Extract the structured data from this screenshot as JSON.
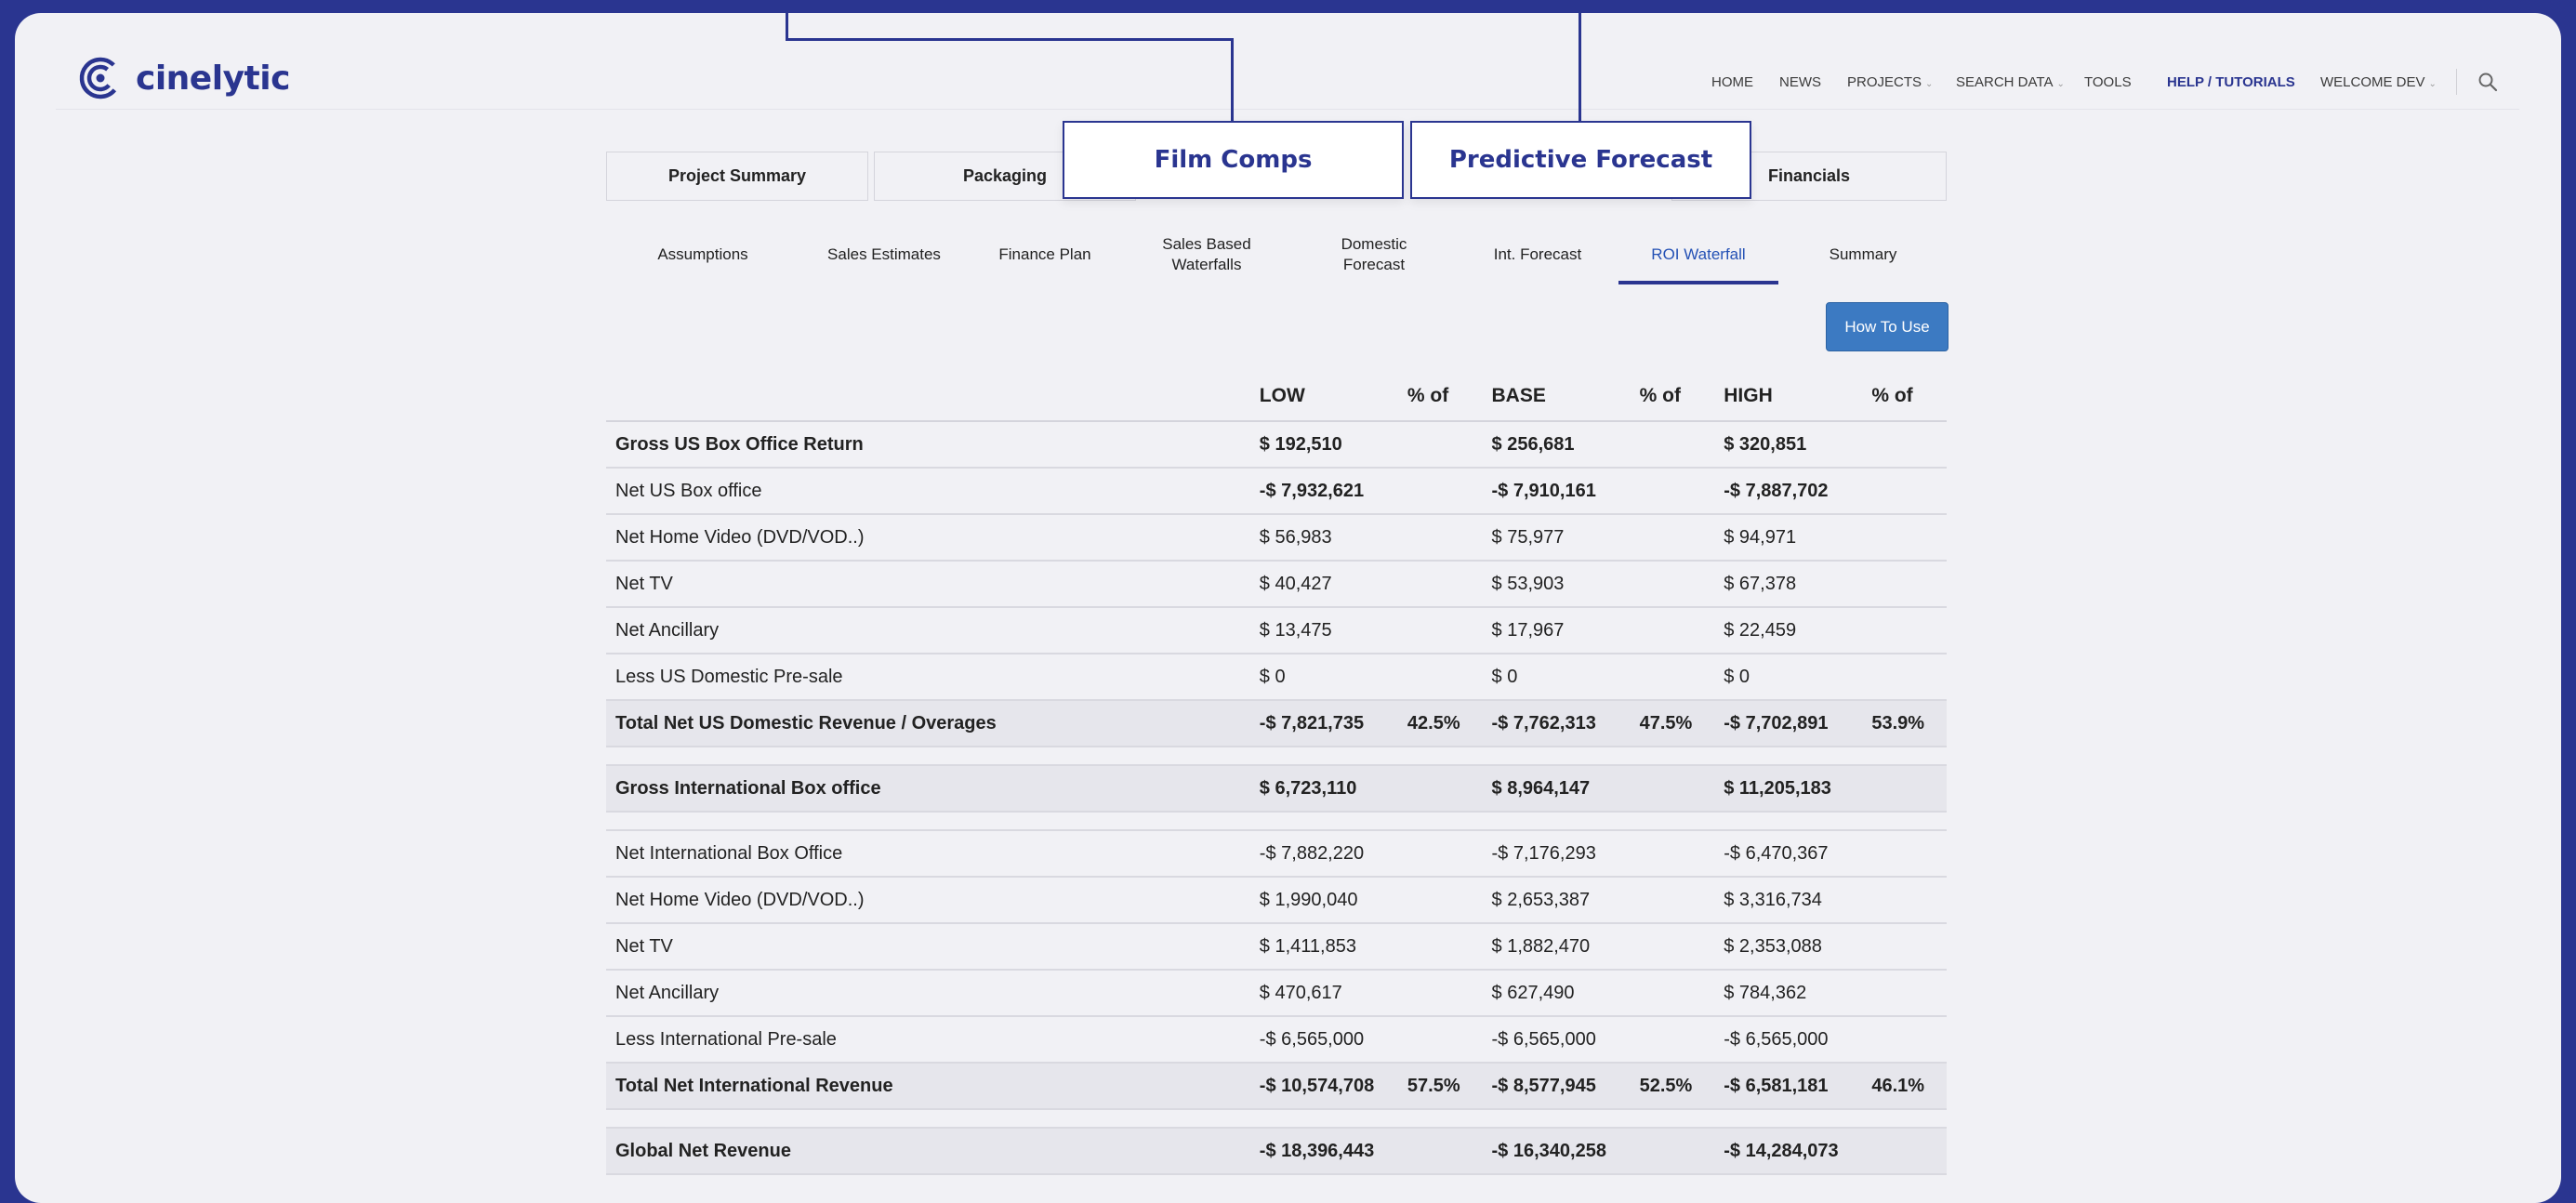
{
  "brand": {
    "name": "cinelytic"
  },
  "nav": {
    "home": "HOME",
    "news": "NEWS",
    "projects": "PROJECTS",
    "search_data": "SEARCH DATA",
    "tools": "TOOLS",
    "help": "HELP / TUTORIALS",
    "welcome": "WELCOME DEV"
  },
  "main_tabs": {
    "project_summary": "Project Summary",
    "packaging": "Packaging",
    "film_comps": "Film Comps",
    "predictive_forecast": "Predictive Forecast",
    "financials": "Financials"
  },
  "sub_tabs": {
    "assumptions": "Assumptions",
    "sales_estimates": "Sales Estimates",
    "finance_plan": "Finance Plan",
    "sales_waterfalls_1": "Sales Based",
    "sales_waterfalls_2": "Waterfalls",
    "domestic_forecast_1": "Domestic",
    "domestic_forecast_2": "Forecast",
    "int_forecast": "Int. Forecast",
    "roi_waterfall": "ROI Waterfall",
    "summary": "Summary"
  },
  "how_to_use": "How To Use",
  "table": {
    "headers": {
      "low": "LOW",
      "pct1": "% of",
      "base": "BASE",
      "pct2": "% of",
      "high": "HIGH",
      "pct3": "% of"
    },
    "rows": [
      {
        "label": "Gross US Box Office Return",
        "low": "$ 192,510",
        "low_pct": "",
        "base": "$ 256,681",
        "base_pct": "",
        "high": "$ 320,851",
        "high_pct": ""
      },
      {
        "label": "Net US Box office",
        "low": "-$ 7,932,621",
        "low_pct": "",
        "base": "-$ 7,910,161",
        "base_pct": "",
        "high": "-$ 7,887,702",
        "high_pct": ""
      },
      {
        "label": "Net Home Video (DVD/VOD..)",
        "low": "$ 56,983",
        "low_pct": "",
        "base": "$ 75,977",
        "base_pct": "",
        "high": "$ 94,971",
        "high_pct": ""
      },
      {
        "label": "Net TV",
        "low": "$ 40,427",
        "low_pct": "",
        "base": "$ 53,903",
        "base_pct": "",
        "high": "$ 67,378",
        "high_pct": ""
      },
      {
        "label": "Net Ancillary",
        "low": "$ 13,475",
        "low_pct": "",
        "base": "$ 17,967",
        "base_pct": "",
        "high": "$ 22,459",
        "high_pct": ""
      },
      {
        "label": "Less US Domestic Pre-sale",
        "low": "$ 0",
        "low_pct": "",
        "base": "$ 0",
        "base_pct": "",
        "high": "$ 0",
        "high_pct": ""
      },
      {
        "label": "Total Net US Domestic Revenue / Overages",
        "low": "-$ 7,821,735",
        "low_pct": "42.5%",
        "base": "-$ 7,762,313",
        "base_pct": "47.5%",
        "high": "-$ 7,702,891",
        "high_pct": "53.9%"
      },
      {
        "label": "Gross International Box office",
        "low": "$ 6,723,110",
        "low_pct": "",
        "base": "$ 8,964,147",
        "base_pct": "",
        "high": "$ 11,205,183",
        "high_pct": ""
      },
      {
        "label": "Net International Box Office",
        "low": "-$ 7,882,220",
        "low_pct": "",
        "base": "-$ 7,176,293",
        "base_pct": "",
        "high": "-$ 6,470,367",
        "high_pct": ""
      },
      {
        "label": "Net Home Video (DVD/VOD..)",
        "low": "$ 1,990,040",
        "low_pct": "",
        "base": "$ 2,653,387",
        "base_pct": "",
        "high": "$ 3,316,734",
        "high_pct": ""
      },
      {
        "label": "Net TV",
        "low": "$ 1,411,853",
        "low_pct": "",
        "base": "$ 1,882,470",
        "base_pct": "",
        "high": "$ 2,353,088",
        "high_pct": ""
      },
      {
        "label": "Net Ancillary",
        "low": "$ 470,617",
        "low_pct": "",
        "base": "$ 627,490",
        "base_pct": "",
        "high": "$ 784,362",
        "high_pct": ""
      },
      {
        "label": "Less International Pre-sale",
        "low": "-$ 6,565,000",
        "low_pct": "",
        "base": "-$ 6,565,000",
        "base_pct": "",
        "high": "-$ 6,565,000",
        "high_pct": ""
      },
      {
        "label": "Total Net International Revenue",
        "low": "-$ 10,574,708",
        "low_pct": "57.5%",
        "base": "-$ 8,577,945",
        "base_pct": "52.5%",
        "high": "-$ 6,581,181",
        "high_pct": "46.1%"
      },
      {
        "label": "Global Net Revenue",
        "low": "-$ 18,396,443",
        "low_pct": "",
        "base": "-$ 16,340,258",
        "base_pct": "",
        "high": "-$ 14,284,073",
        "high_pct": ""
      }
    ]
  }
}
